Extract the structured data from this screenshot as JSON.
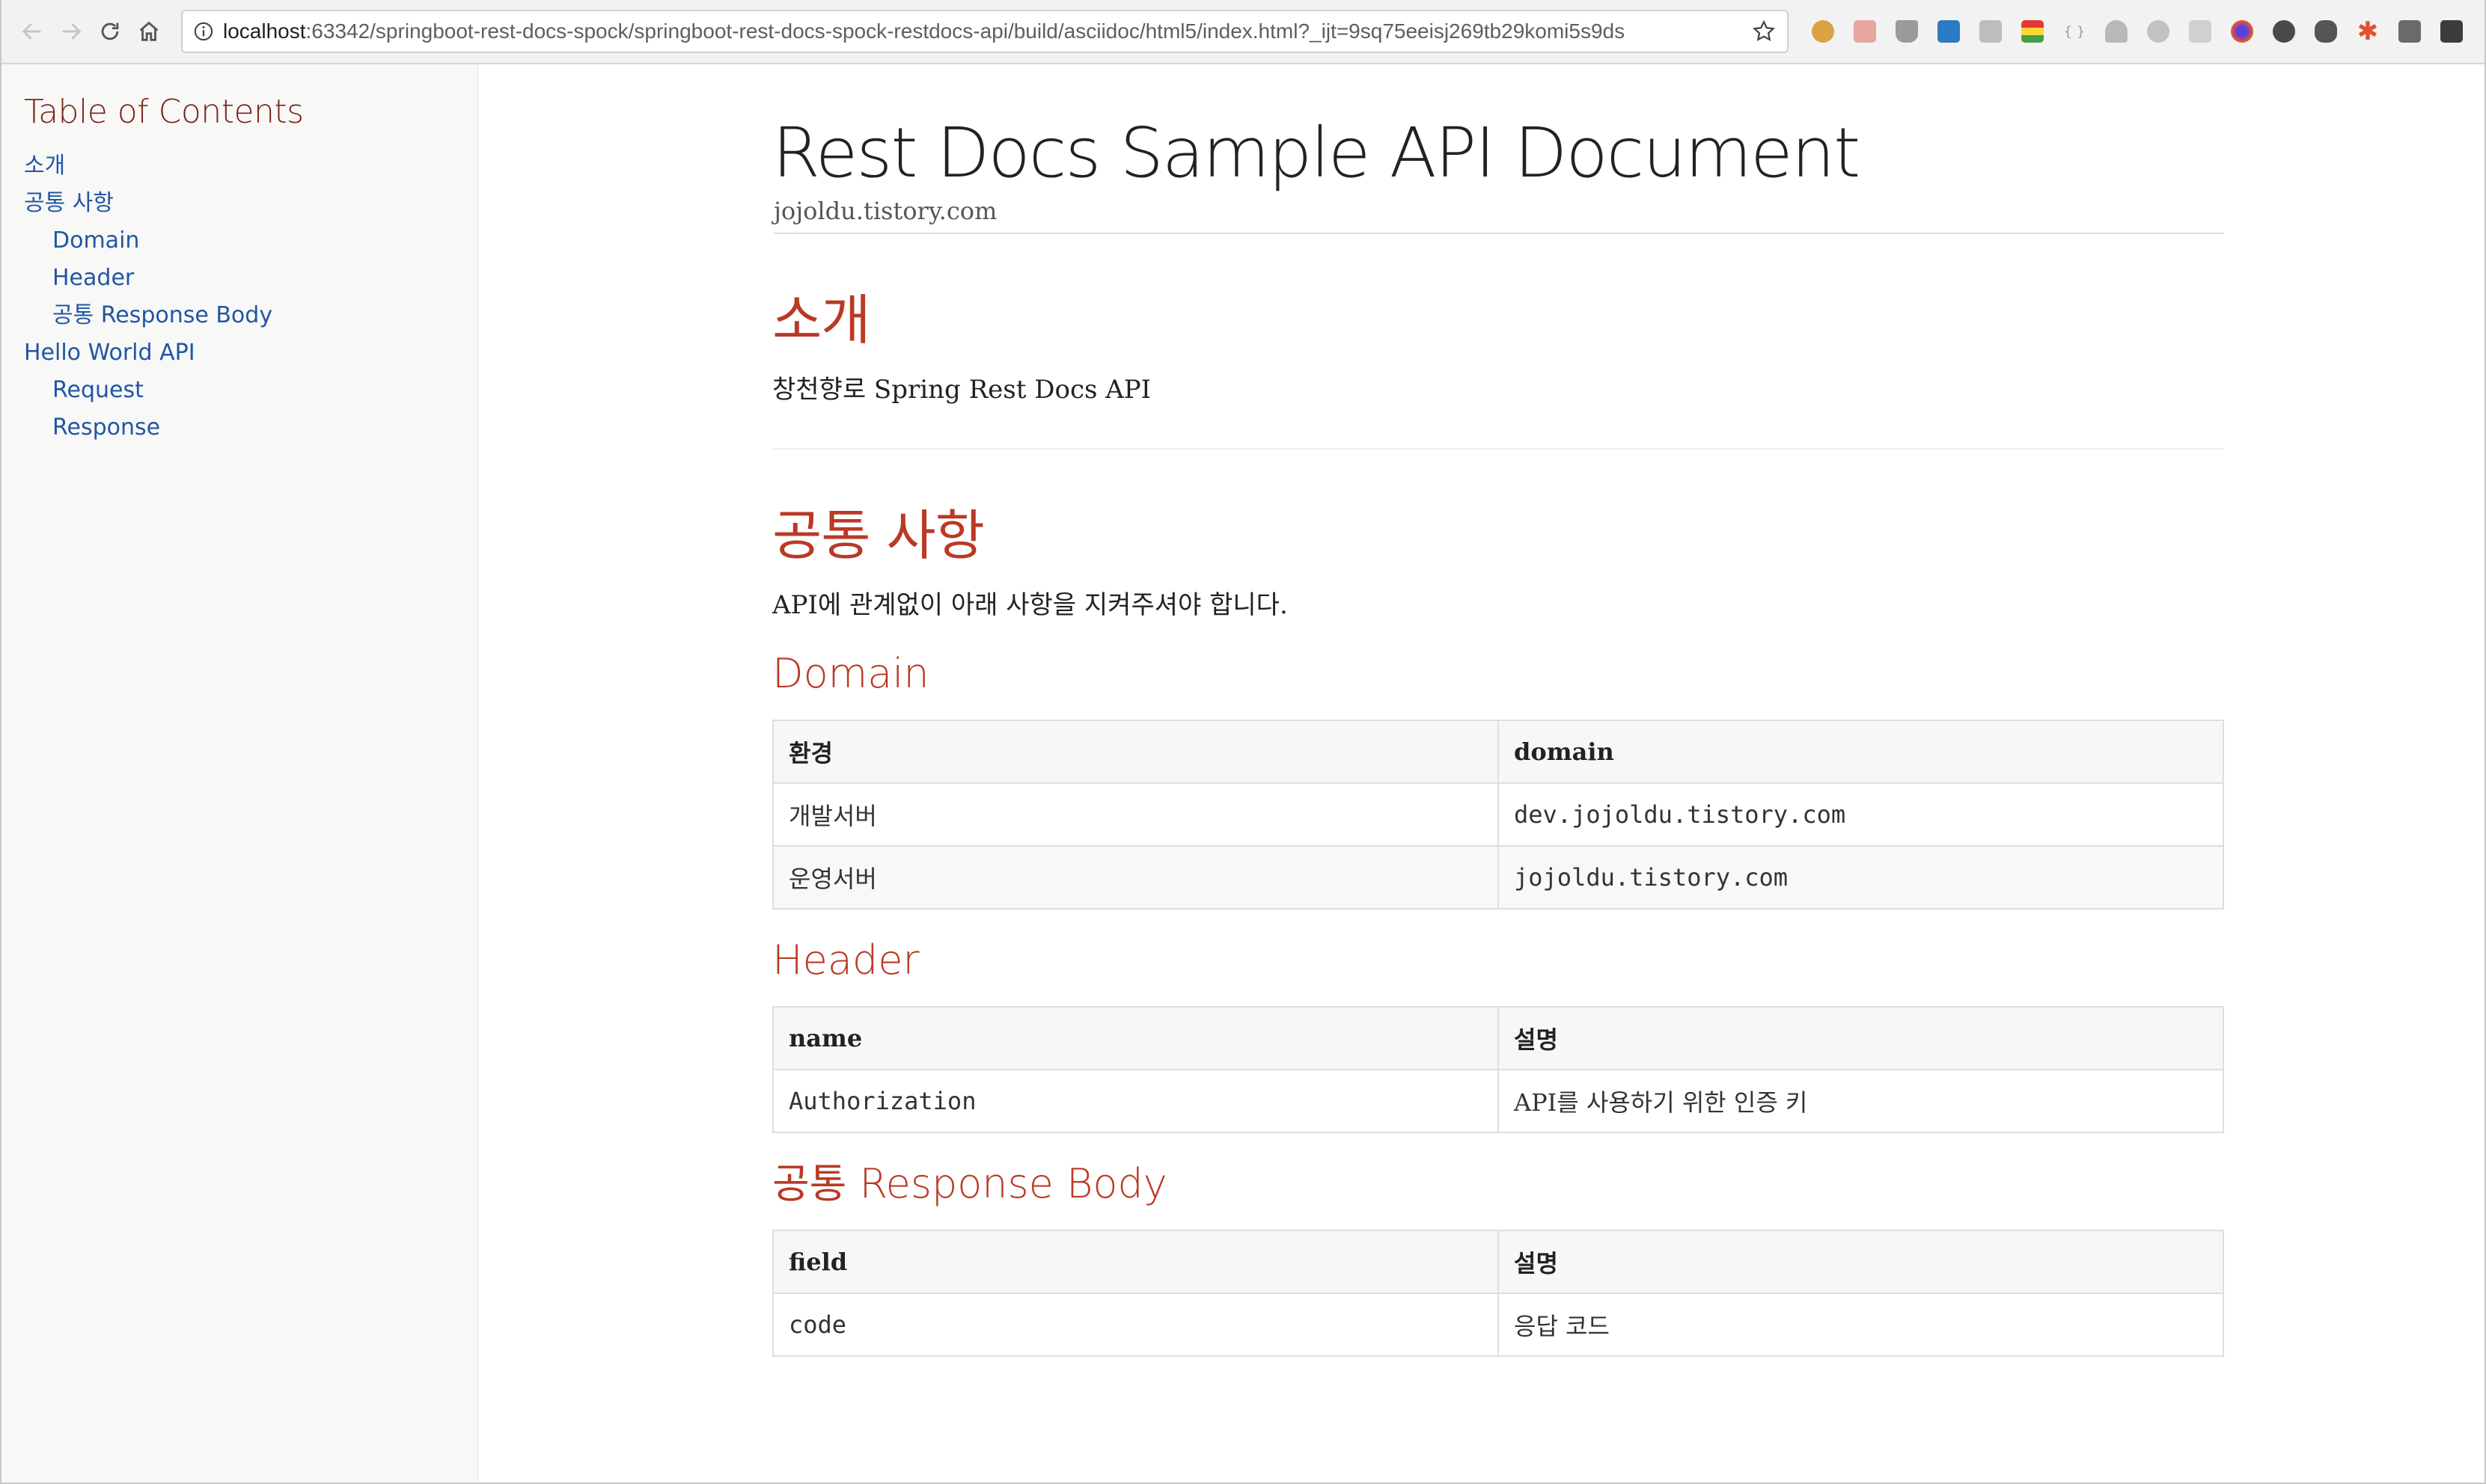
{
  "browser": {
    "url_host": "localhost",
    "url_rest": ":63342/springboot-rest-docs-spock/springboot-rest-docs-spock-restdocs-api/build/asciidoc/html5/index.html?_ijt=9sq75eeisj269tb29komi5s9ds"
  },
  "toc": {
    "title": "Table of Contents",
    "items": [
      {
        "label": "소개"
      },
      {
        "label": "공통 사항"
      },
      {
        "label": "Domain"
      },
      {
        "label": "Header"
      },
      {
        "label": "공통 Response Body"
      },
      {
        "label": "Hello World API"
      },
      {
        "label": "Request"
      },
      {
        "label": "Response"
      }
    ]
  },
  "doc": {
    "title": "Rest Docs Sample API Document",
    "author": "jojoldu.tistory.com",
    "intro": {
      "heading": "소개",
      "text": "창천향로 Spring Rest Docs API"
    },
    "common": {
      "heading": "공통 사항",
      "text": "API에 관계없이 아래 사항을 지켜주셔야 합니다."
    },
    "domain": {
      "heading": "Domain",
      "header": [
        "환경",
        "domain"
      ],
      "rows": [
        [
          "개발서버",
          "dev.jojoldu.tistory.com"
        ],
        [
          "운영서버",
          "jojoldu.tistory.com"
        ]
      ]
    },
    "header_section": {
      "heading": "Header",
      "header": [
        "name",
        "설명"
      ],
      "rows": [
        [
          "Authorization",
          "API를 사용하기 위한 인증 키"
        ]
      ]
    },
    "response_body": {
      "heading": "공통 Response Body",
      "header": [
        "field",
        "설명"
      ],
      "rows": [
        [
          "code",
          "응답 코드"
        ]
      ]
    }
  },
  "colors": {
    "heading": "#ba3925",
    "toc_title": "#7a2518",
    "link": "#2156a5"
  }
}
